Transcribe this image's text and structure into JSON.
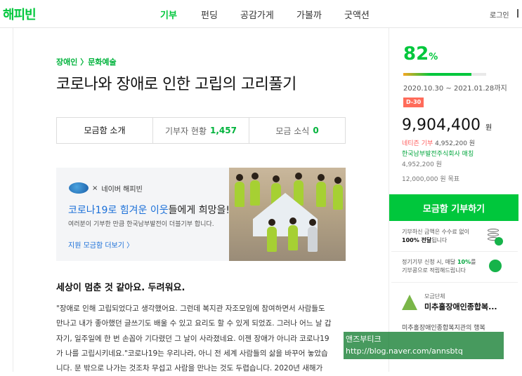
{
  "header": {
    "logo": "해피빈",
    "nav": [
      "기부",
      "펀딩",
      "공감가게",
      "가볼까",
      "굿액션"
    ],
    "login": "로그인"
  },
  "main": {
    "breadcrumb": "장애인 〉문화예술",
    "title": "코로나와 장애로 인한 고립의 고리풀기",
    "tabs": [
      {
        "label": "모금함 소개",
        "count": ""
      },
      {
        "label": "기부자 현황",
        "count": "1,457"
      },
      {
        "label": "모금 소식",
        "count": "0"
      }
    ],
    "banner": {
      "logo_x": "×",
      "partner": "네이버 해피빈",
      "headline_hl": "코로나19로 힘겨운 이웃",
      "headline_rest": "들에게 희망을!",
      "sub": "여러분이 기부한 만큼 한국남부발전이 더블기부 합니다.",
      "link": "지원 모금함 더보기 〉"
    },
    "section_title": "세상이 멈춘 것 같아요. 두려워요.",
    "body_lines": [
      "\"장애로 인해 고립되었다고 생각했어요. 그런데 복지관 자조모임에 참여하면서 사람들도",
      "만나고 내가 좋아했던 글쓰기도 배울 수 있고 요리도 할 수 있게 되었죠. 그러나 어느 날 갑",
      "자기, 일주일에 한 번 손꼽아 기다렸던 그 날이 사라졌네요. 이젠 장애가 아니라 코로나19",
      "가 나를 고립시키네요.\"코로나19는 우리나라, 아니 전 세계 사람들의 삶을 바꾸어 놓았습",
      "니다. 문 밖으로 나가는 것조차 무섭고 사람을 만나는 것도 두렵습니다. 2020년 새해가"
    ]
  },
  "side": {
    "percent_value": "82",
    "percent_unit": "%",
    "progress": 0.82,
    "dates": "2020.10.30 ~ 2021.01.28까지",
    "dday": "D-30",
    "amount": "9,904,400",
    "amount_unit": "원",
    "netizen_label": "네티즌 기부",
    "netizen_amount": "4,952,200 원",
    "match_label": "한국남부발전주식회사 매칭",
    "match_amount": "4,952,200 원",
    "goal": "12,000,000 원 목표",
    "donate_button": "모금함 기부하기",
    "info1_a": "기부하신 금액은 수수료 없이",
    "info1_b": "100% 전달",
    "info1_c": "됩니다",
    "info2_a": "정기기부 신청 시, 매달 ",
    "info2_b": "10%",
    "info2_c": "를",
    "info2_d": "기부콩으로 적립해드립니다",
    "org_label": "모금단체",
    "org_name": "미추홀장애인종합복...",
    "org_desc": "미추홀장애인종합복지관의 행복"
  },
  "watermark": {
    "line1": "앤즈부티크",
    "line2": "http://blog.naver.com/annsbtq"
  },
  "colors": {
    "brand_green": "#00c73c",
    "dday_red": "#ff6b5a",
    "link_blue": "#1a6fd8"
  }
}
